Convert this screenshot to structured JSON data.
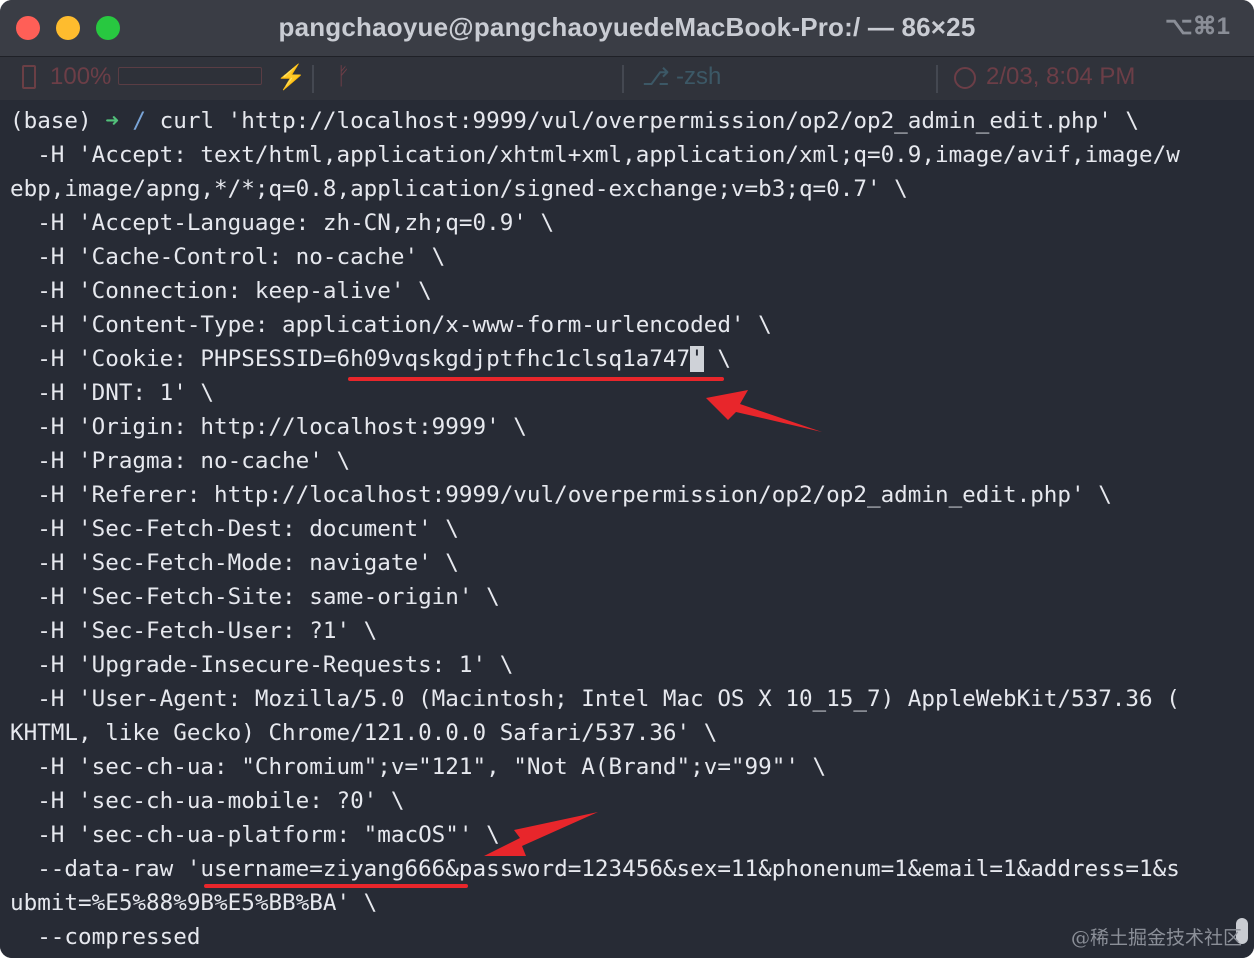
{
  "window": {
    "title": "pangchaoyue@pangchaoyuedeMacBook-Pro:/ — 86×25",
    "shortcut": "⌥⌘1"
  },
  "statusbar": {
    "battery": "100%",
    "bolt_icon": "⚡",
    "branch_icon": "ᚠ",
    "git_icon": "⎇",
    "shell": "-zsh",
    "datetime": "2/03, 8:04 PM"
  },
  "terminal": {
    "prompt_env": "(base) ",
    "prompt_arrow": "➜",
    "prompt_dir": " / ",
    "lines": [
      "curl 'http://localhost:9999/vul/overpermission/op2/op2_admin_edit.php' \\",
      "  -H 'Accept: text/html,application/xhtml+xml,application/xml;q=0.9,image/avif,image/w",
      "ebp,image/apng,*/*;q=0.8,application/signed-exchange;v=b3;q=0.7' \\",
      "  -H 'Accept-Language: zh-CN,zh;q=0.9' \\",
      "  -H 'Cache-Control: no-cache' \\",
      "  -H 'Connection: keep-alive' \\",
      "  -H 'Content-Type: application/x-www-form-urlencoded' \\",
      "  -H 'Cookie: PHPSESSID=6h09vqskgdjptfhc1clsq1a747",
      "  -H 'DNT: 1' \\",
      "  -H 'Origin: http://localhost:9999' \\",
      "  -H 'Pragma: no-cache' \\",
      "  -H 'Referer: http://localhost:9999/vul/overpermission/op2/op2_admin_edit.php' \\",
      "  -H 'Sec-Fetch-Dest: document' \\",
      "  -H 'Sec-Fetch-Mode: navigate' \\",
      "  -H 'Sec-Fetch-Site: same-origin' \\",
      "  -H 'Sec-Fetch-User: ?1' \\",
      "  -H 'Upgrade-Insecure-Requests: 1' \\",
      "  -H 'User-Agent: Mozilla/5.0 (Macintosh; Intel Mac OS X 10_15_7) AppleWebKit/537.36 (",
      "KHTML, like Gecko) Chrome/121.0.0.0 Safari/537.36' \\",
      "  -H 'sec-ch-ua: \"Chromium\";v=\"121\", \"Not A(Brand\";v=\"99\"' \\",
      "  -H 'sec-ch-ua-mobile: ?0' \\",
      "  -H 'sec-ch-ua-platform: \"macOS\"' \\",
      "  --data-raw 'username=ziyang666&password=123456&sex=11&phonenum=1&email=1&address=1&s",
      "ubmit=%E5%88%9B%E5%BB%BA' \\",
      "  --compressed"
    ],
    "cookie_cursor_char": "'",
    "cookie_tail": " \\"
  },
  "colors": {
    "terminal_bg": "#272b35",
    "text": "#e6e8ee",
    "prompt_green": "#52c07a",
    "annotation_red": "#e8262b"
  },
  "watermark": "@稀土掘金技术社区"
}
